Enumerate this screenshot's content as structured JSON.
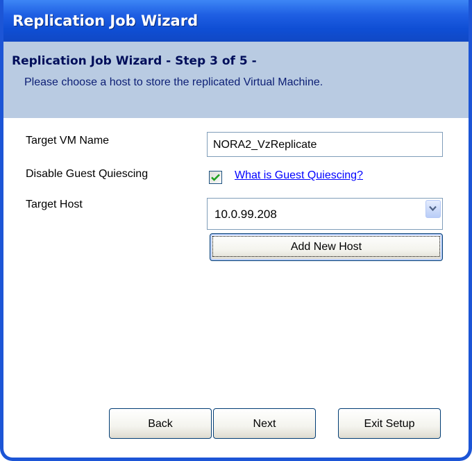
{
  "window": {
    "title": "Replication Job Wizard"
  },
  "header": {
    "title": "Replication Job Wizard - Step 3 of 5 -",
    "subtitle": "Please choose a host to store the replicated Virtual Machine."
  },
  "form": {
    "target_vm_name_label": "Target VM Name",
    "target_vm_name_value": "NORA2_VzReplicate",
    "disable_quiescing_label": "Disable Guest Quiescing",
    "disable_quiescing_checked": true,
    "quiescing_help_link": "What is Guest Quiescing?",
    "target_host_label": "Target Host",
    "target_host_value": "10.0.99.208",
    "add_host_button": "Add New Host"
  },
  "footer": {
    "back_label": "Back",
    "next_label": "Next",
    "exit_label": "Exit Setup"
  },
  "colors": {
    "titlebar": "#1f5fe3",
    "header_band": "#b9cbe2",
    "link": "#0000ff",
    "checkmark": "#21a121"
  }
}
